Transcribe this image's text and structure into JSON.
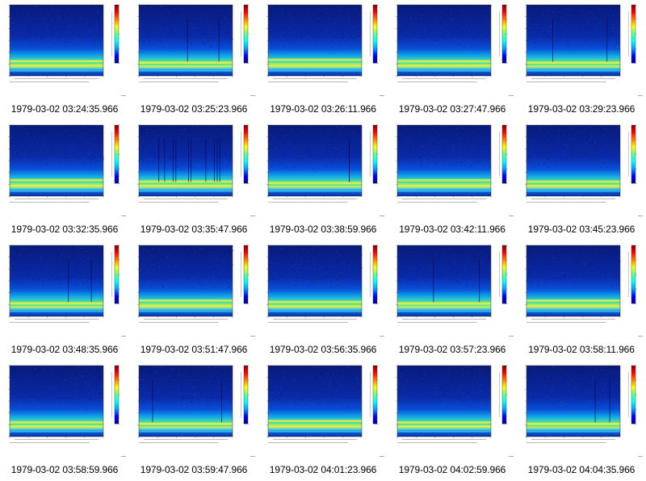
{
  "gallery": {
    "items": [
      {
        "caption": "1979-03-02 03:24:35.966",
        "variant": 0
      },
      {
        "caption": "1979-03-02 03:25:23.966",
        "variant": 1
      },
      {
        "caption": "1979-03-02 03:26:11.966",
        "variant": 2
      },
      {
        "caption": "1979-03-02 03:27:47.966",
        "variant": 3
      },
      {
        "caption": "1979-03-02 03:29:23.966",
        "variant": 4
      },
      {
        "caption": "1979-03-02 03:32:35.966",
        "variant": 5
      },
      {
        "caption": "1979-03-02 03:35:47.966",
        "variant": 6
      },
      {
        "caption": "1979-03-02 03:38:59.966",
        "variant": 7
      },
      {
        "caption": "1979-03-02 03:42:11.966",
        "variant": 8
      },
      {
        "caption": "1979-03-02 03:45:23.966",
        "variant": 9
      },
      {
        "caption": "1979-03-02 03:48:35.966",
        "variant": 10
      },
      {
        "caption": "1979-03-02 03:51:47.966",
        "variant": 11
      },
      {
        "caption": "1979-03-02 03:56:35.966",
        "variant": 12
      },
      {
        "caption": "1979-03-02 03:57:23.966",
        "variant": 13
      },
      {
        "caption": "1979-03-02 03:58:11.966",
        "variant": 14
      },
      {
        "caption": "1979-03-02 03:58:59.966",
        "variant": 15
      },
      {
        "caption": "1979-03-02 03:59:47.966",
        "variant": 16
      },
      {
        "caption": "1979-03-02 04:01:23.966",
        "variant": 17
      },
      {
        "caption": "1979-03-02 04:02:59.966",
        "variant": 18
      },
      {
        "caption": "1979-03-02 04:04:35.966",
        "variant": 19
      }
    ]
  },
  "thumbnail": {
    "type": "heatmap",
    "colormap": [
      "#00008f",
      "#0000ff",
      "#00a0ff",
      "#00ffff",
      "#60ff90",
      "#ffff00",
      "#ff8000",
      "#ff0000",
      "#800000"
    ],
    "background_color": "#0a1a8c"
  },
  "chart_data": {
    "type": "heatmap",
    "panel_count": 20,
    "grid": "4 rows x 5 columns",
    "captions": [
      "1979-03-02 03:24:35.966",
      "1979-03-02 03:25:23.966",
      "1979-03-02 03:26:11.966",
      "1979-03-02 03:27:47.966",
      "1979-03-02 03:29:23.966",
      "1979-03-02 03:32:35.966",
      "1979-03-02 03:35:47.966",
      "1979-03-02 03:38:59.966",
      "1979-03-02 03:42:11.966",
      "1979-03-02 03:45:23.966",
      "1979-03-02 03:48:35.966",
      "1979-03-02 03:51:47.966",
      "1979-03-02 03:56:35.966",
      "1979-03-02 03:57:23.966",
      "1979-03-02 03:58:11.966",
      "1979-03-02 03:58:59.966",
      "1979-03-02 03:59:47.966",
      "1979-03-02 04:01:23.966",
      "1979-03-02 04:02:59.966",
      "1979-03-02 04:04:35.966"
    ]
  }
}
